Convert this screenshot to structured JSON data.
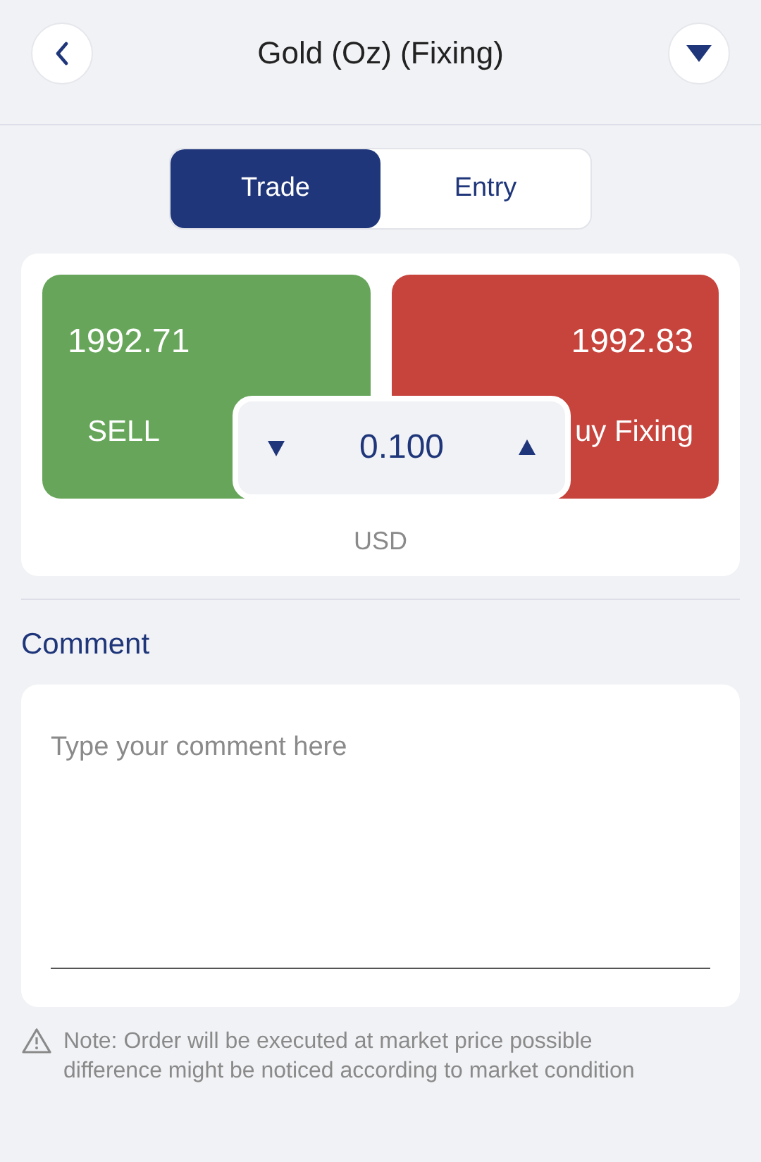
{
  "header": {
    "title": "Gold (Oz) (Fixing)"
  },
  "tabs": [
    {
      "label": "Trade",
      "selected": true
    },
    {
      "label": "Entry",
      "selected": false
    }
  ],
  "quote": {
    "sell": {
      "price": "1992.71",
      "label": "SELL"
    },
    "buy": {
      "price": "1992.83",
      "label": "uy Fixing"
    },
    "quantity": "0.100",
    "currency": "USD"
  },
  "comment": {
    "label": "Comment",
    "placeholder": "Type your comment here"
  },
  "note": "Note: Order will be executed at market price possible difference might be noticed according to market condition"
}
